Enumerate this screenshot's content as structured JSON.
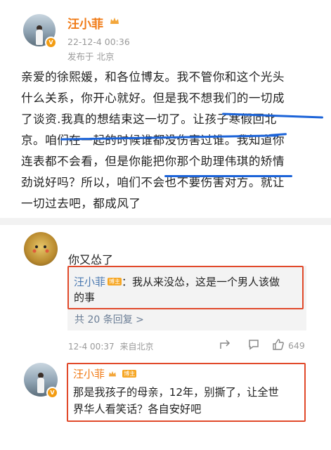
{
  "post": {
    "author": "汪小菲",
    "time": "22-12-4 00:36",
    "location": "发布于 北京",
    "content_lines": [
      "亲爱的徐熙媛，和各位博友。我不管你和这个光头",
      "什么关系，你开心就好。但是我不想我们的一切成",
      "了谈资.我真的想结束这一切了。让孩子寒假回北",
      "京。咱们在一起的时候谁都没伤害过谁。我知道你",
      "连表都不会看，但是你能把你那个助理伟琪的矫情",
      "劲说好吗？所以，咱们不会也不要伤害对方。就让",
      "一切过去吧，都成风了"
    ]
  },
  "comment": {
    "text": "你又怂了",
    "reply_author": "汪小菲",
    "reply_badge": "博主",
    "reply_text_line1": "：我从来没怂，这是一个男人该做",
    "reply_text_line2": "的事",
    "more_replies": "共 20 条回复 >",
    "time": "12-4 00:37",
    "location": "来自北京",
    "like_count": "649"
  },
  "comment2": {
    "author": "汪小菲",
    "badge": "博主",
    "line1": "那是我孩子的母亲，12年，别撕了，让全世",
    "line2": "界华人看笑话？各自安好吧"
  },
  "colors": {
    "name_orange": "#f07a15",
    "underline_blue": "#1b63d8",
    "box_red": "#e1492a"
  }
}
